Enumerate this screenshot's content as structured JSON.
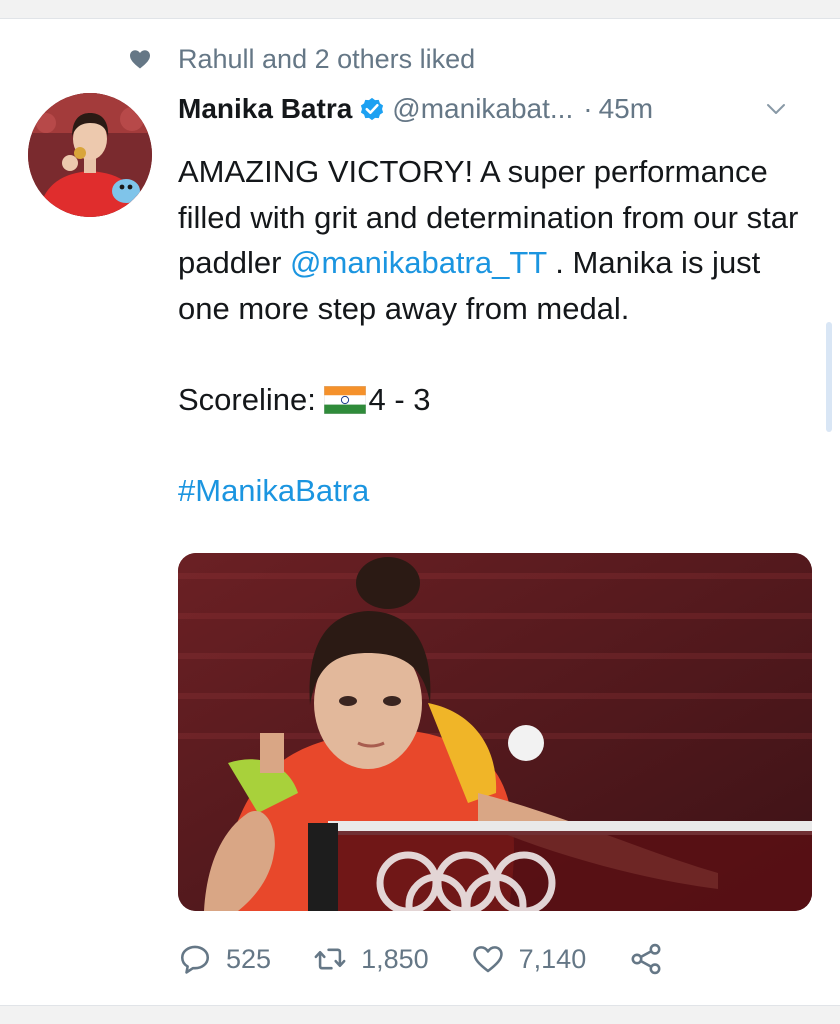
{
  "social_context": {
    "text": "Rahull and 2 others liked",
    "icon": "heart-icon"
  },
  "author": {
    "name": "Manika Batra",
    "handle": "@manikabat...",
    "separator": "·",
    "time": "45m",
    "verified": true
  },
  "tweet": {
    "line1": "AMAZING VICTORY! A super performance filled with grit and determination from our star paddler",
    "mention": "@manikabatra_TT",
    "line1_end": " . Manika is just one more step away from medal.",
    "score_label": "Scoreline: ",
    "score": "4 - 3",
    "hashtag": "#ManikaBatra"
  },
  "actions": {
    "replies": "525",
    "retweets": "1,850",
    "likes": "7,140"
  },
  "colors": {
    "link": "#1b95e0",
    "secondary_text": "#657786",
    "primary_text": "#14171a",
    "verified_badge": "#1da1f2"
  }
}
